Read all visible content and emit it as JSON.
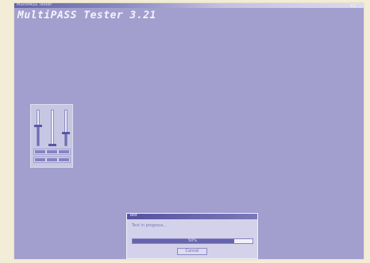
{
  "window": {
    "titlebar_text": "MultiPASS Tester",
    "app_title": "MultiPASS Tester 3.21"
  },
  "mixer": {
    "faders": [
      {
        "level": 0.55
      },
      {
        "level": 0.0
      },
      {
        "level": 0.35
      }
    ]
  },
  "dialog": {
    "title": "Test",
    "message": "Test in progress...",
    "progress_label": "50%",
    "progress": 0.85,
    "button_label": "Cancel"
  },
  "colors": {
    "desktop": "#a29fce",
    "accent": "#6664ad"
  }
}
